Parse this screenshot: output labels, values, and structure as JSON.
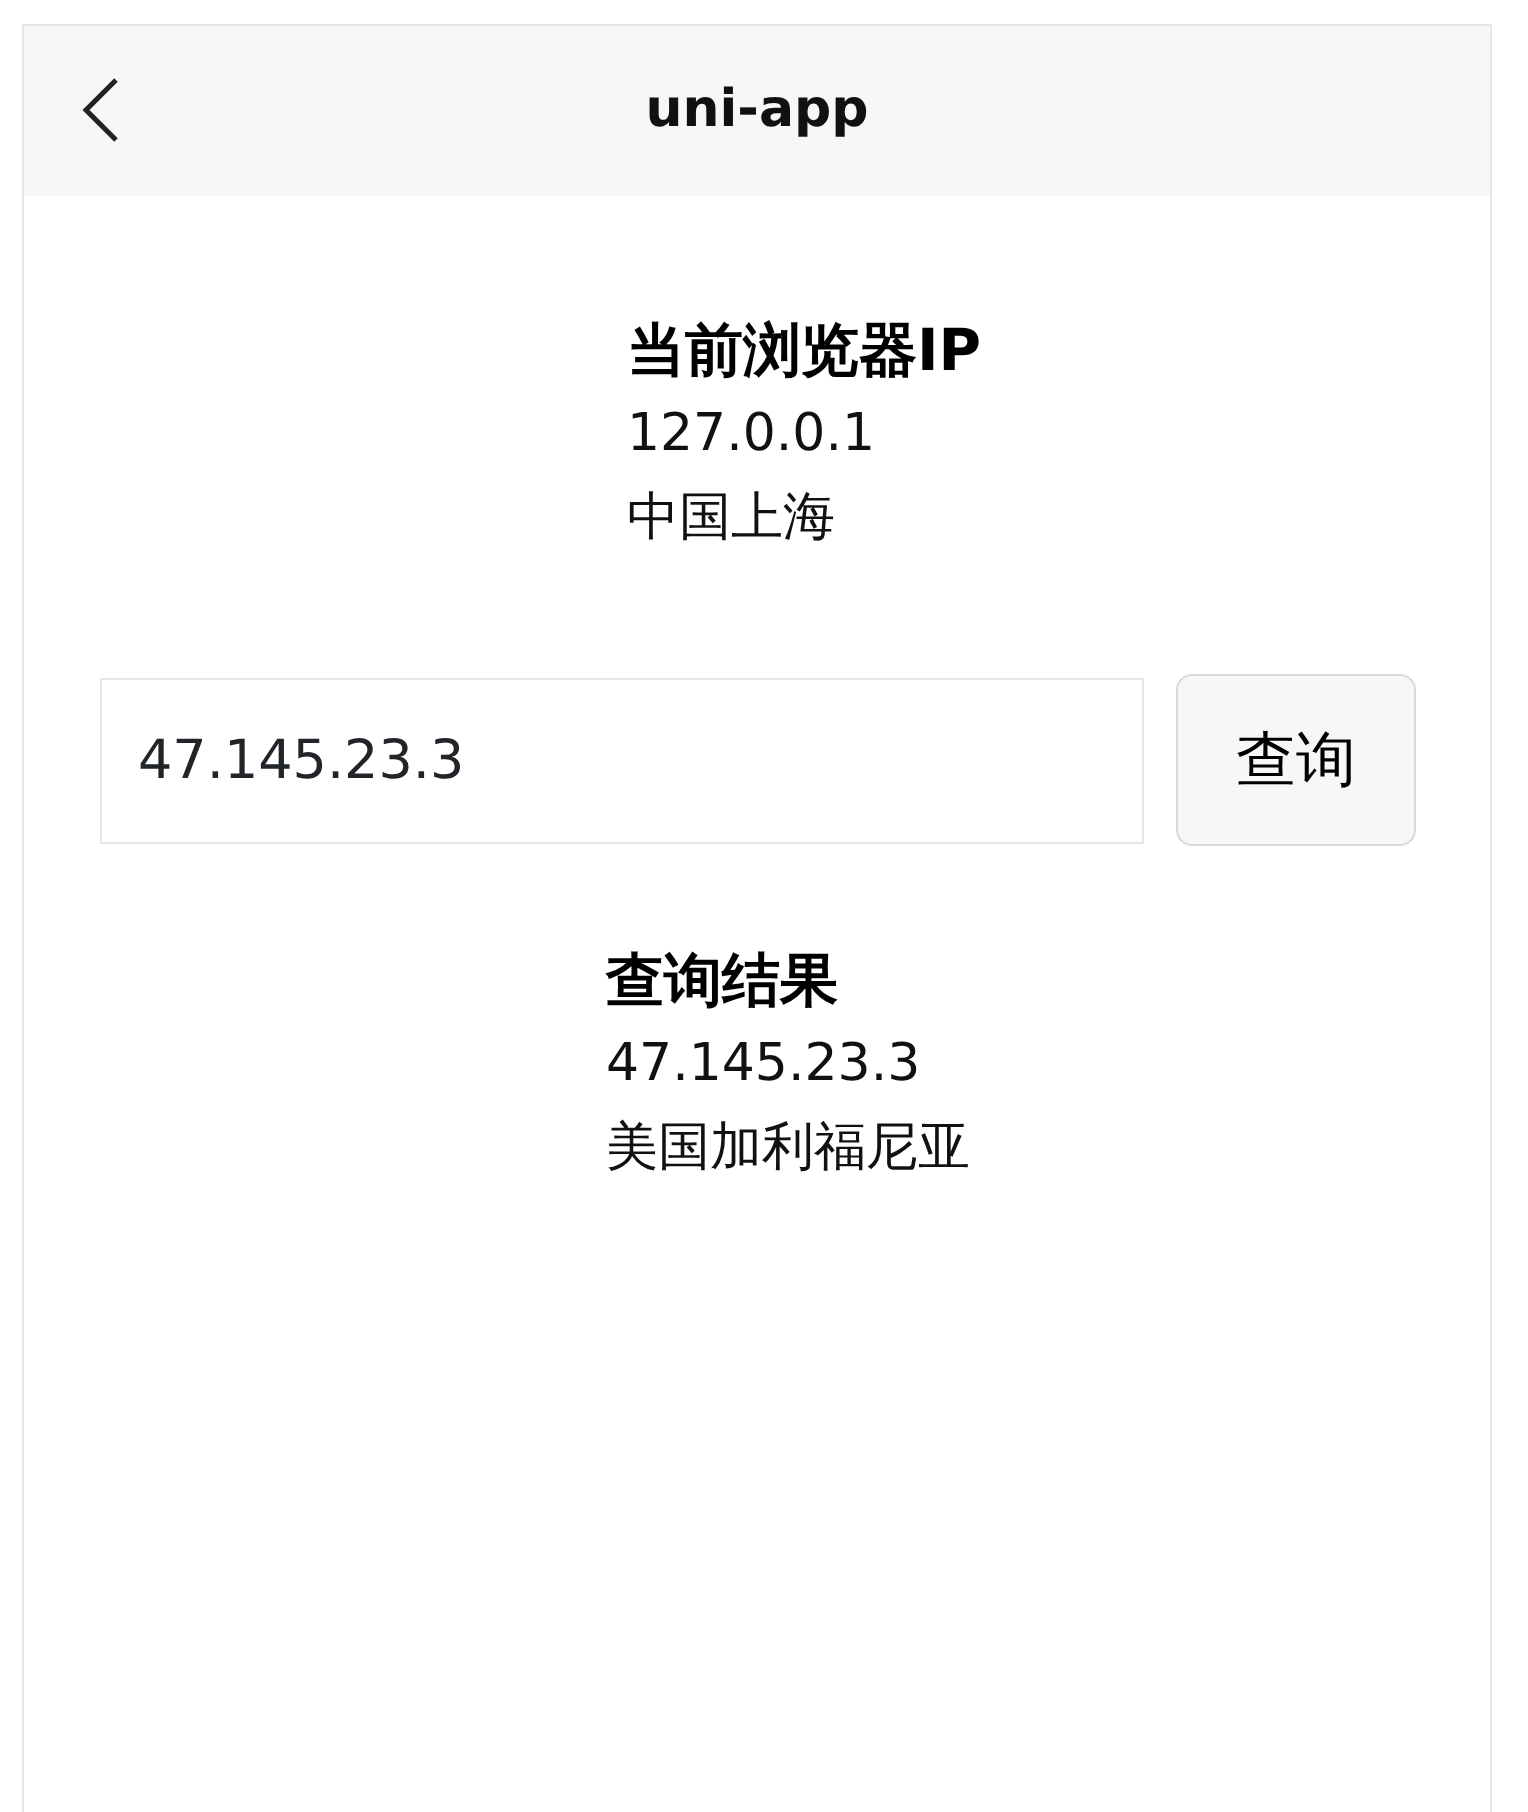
{
  "navbar": {
    "title": "uni-app"
  },
  "current_ip": {
    "heading": "当前浏览器IP",
    "ip": "127.0.0.1",
    "location": "中国上海"
  },
  "query": {
    "value": "47.145.23.3",
    "button": "查询"
  },
  "result": {
    "heading": "查询结果",
    "ip": "47.145.23.3",
    "location": "美国加利福尼亚"
  }
}
